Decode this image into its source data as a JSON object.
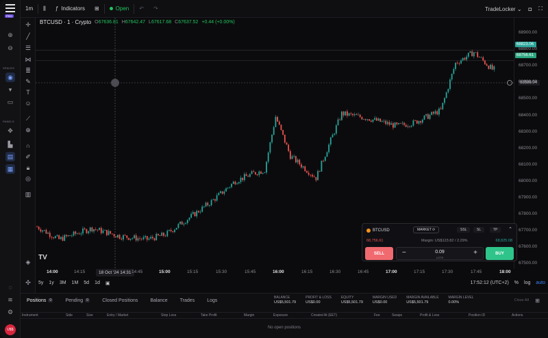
{
  "toolbar": {
    "interval": "1m",
    "indicators_label": "Indicators",
    "market_status": "Open",
    "brand": "TradeLocker"
  },
  "sidebar": {
    "plan_badge": "PRO",
    "spaces_label": "SPACES",
    "panels_label": "PANELS",
    "avatar_initials": "U$$"
  },
  "legend": {
    "symbol": "BTCUSD · 1 · Crypto",
    "open_label": "O",
    "open": "67636.81",
    "high_label": "H",
    "high": "67642.47",
    "low_label": "L",
    "low": "67617.68",
    "close_label": "C",
    "close": "67637.52",
    "change": "+0.44 (+0.00%)"
  },
  "price_axis": {
    "ticks": [
      "68900.00",
      "68800.00",
      "68700.00",
      "68600.00",
      "68500.00",
      "68400.00",
      "68300.00",
      "68200.00",
      "68100.00",
      "68000.00",
      "67900.00",
      "67800.00",
      "67700.00",
      "67600.00",
      "67500.00"
    ],
    "ask_tag": "68823.06",
    "bid_tag": "68756.61",
    "cursor_tag": "68589.04"
  },
  "time_axis": {
    "ticks": [
      "14:00",
      "14:15",
      "14:45",
      "15:00",
      "15:15",
      "15:30",
      "15:45",
      "16:00",
      "16:15",
      "16:30",
      "16:45",
      "17:00",
      "17:15",
      "17:30",
      "17:45",
      "18:00"
    ],
    "cursor_date": "18 Oct '24  14:31"
  },
  "range_bar": {
    "ranges": [
      "5y",
      "1y",
      "3M",
      "1M",
      "5d",
      "1d"
    ],
    "clock": "17:52:12 (UTC+2)",
    "percent": "%",
    "log": "log",
    "auto": "auto"
  },
  "order_panel": {
    "symbol": "BTCUSD",
    "order_type": "MARKET",
    "tabs": [
      "SSL",
      "SL",
      "TP"
    ],
    "bid": "68,756.61",
    "ask": "68,825.08",
    "margin": "Margin: US$123.82 / 2.29%",
    "sell_label": "SELL",
    "buy_label": "BUY",
    "quantity": "0.09",
    "quantity_unit": "LOTS"
  },
  "bottom": {
    "tabs": [
      {
        "label": "Positions",
        "count": "0"
      },
      {
        "label": "Pending",
        "count": "0"
      },
      {
        "label": "Closed Positions"
      },
      {
        "label": "Balance"
      },
      {
        "label": "Trades"
      },
      {
        "label": "Logs"
      }
    ],
    "stats": [
      {
        "label": "BALANCE",
        "value": "US$5,501.79"
      },
      {
        "label": "PROFIT & LOSS",
        "value": "US$0.00"
      },
      {
        "label": "EQUITY",
        "value": "US$5,501.79"
      },
      {
        "label": "MARGIN USED",
        "value": "US$0.00"
      },
      {
        "label": "MARGIN AVAILABLE",
        "value": "US$5,501.79"
      },
      {
        "label": "MARGIN LEVEL",
        "value": "0.00%"
      }
    ],
    "close_all": "Close All",
    "columns": [
      "Instrument",
      "Side",
      "Size",
      "Entry / Market",
      "Stop Loss",
      "Take Profit",
      "Margin",
      "Exposure",
      "Created At (EET)",
      "Fee",
      "Swaps",
      "Profit & Loss",
      "Position ID",
      "Actions"
    ],
    "empty_message": "No open positions"
  },
  "colors": {
    "up": "#26a69a",
    "down": "#ef5350",
    "accent": "#3b82f6",
    "buy": "#2fc48a",
    "sell": "#f06a70"
  },
  "chart_data": {
    "type": "candlestick",
    "ylim": [
      67480,
      68950
    ],
    "anchors": [
      [
        0,
        67700
      ],
      [
        12,
        67620
      ],
      [
        30,
        67690
      ],
      [
        45,
        67640
      ],
      [
        60,
        67620
      ],
      [
        70,
        67650
      ],
      [
        88,
        67800
      ],
      [
        95,
        67860
      ],
      [
        108,
        67990
      ],
      [
        118,
        68040
      ],
      [
        124,
        68060
      ],
      [
        130,
        68400
      ],
      [
        138,
        68150
      ],
      [
        152,
        68010
      ],
      [
        160,
        68250
      ],
      [
        166,
        68420
      ],
      [
        180,
        68390
      ],
      [
        196,
        68340
      ],
      [
        205,
        68360
      ],
      [
        220,
        68440
      ],
      [
        228,
        68740
      ],
      [
        238,
        68810
      ],
      [
        248,
        68700
      ]
    ]
  }
}
